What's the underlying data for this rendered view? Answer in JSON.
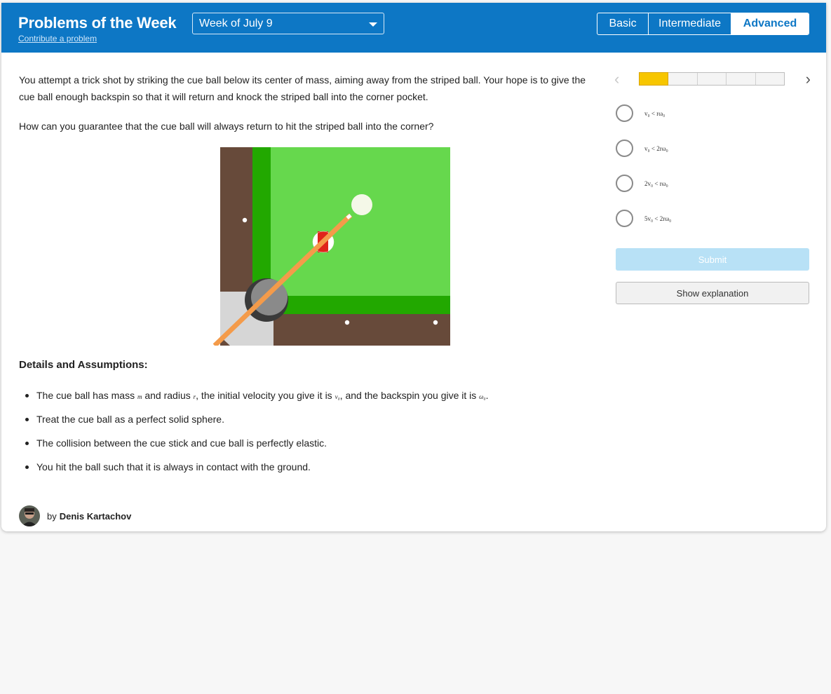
{
  "header": {
    "title": "Problems of the Week",
    "contribute_link": "Contribute a problem",
    "week_select": "Week of July 9",
    "levels": [
      "Basic",
      "Intermediate",
      "Advanced"
    ],
    "active_level": "Advanced"
  },
  "problem": {
    "paragraph_1": "You attempt a trick shot by striking the cue ball below its center of mass, aiming away from the striped ball. Your hope is to give the cue ball enough backspin so that it will return and knock the striped ball into the corner pocket.",
    "paragraph_2": "How can you guarantee that the cue ball will always return to hit the striped ball into the corner?",
    "details_title": "Details and Assumptions:",
    "bullets": {
      "b1_a": "The cue ball has mass ",
      "b1_m": "m",
      "b1_b": " and radius ",
      "b1_r": "r",
      "b1_c": ", the initial velocity you give it is ",
      "b1_v": "v₀",
      "b1_d": ", and the backspin you give it is ",
      "b1_w": "ω₀",
      "b1_e": ".",
      "b2": "Treat the cue ball as a perfect solid sphere.",
      "b3": "The collision between the cue stick and cue ball is perfectly elastic.",
      "b4": "You hit the ball such that it is always in contact with the ground."
    }
  },
  "author": {
    "by": "by",
    "name": "Denis Kartachov"
  },
  "sidebar": {
    "progress": {
      "current": 1,
      "total": 5
    },
    "choices": [
      "v₀ < rω₀",
      "v₀ < 2rω₀",
      "2v₀ < rω₀",
      "5v₀ < 2rω₀"
    ],
    "submit_label": "Submit",
    "explanation_label": "Show explanation"
  },
  "colors": {
    "header_blue": "#0d77c5",
    "progress_yellow": "#f7c600",
    "submit_disabled": "#b8e1f6"
  }
}
